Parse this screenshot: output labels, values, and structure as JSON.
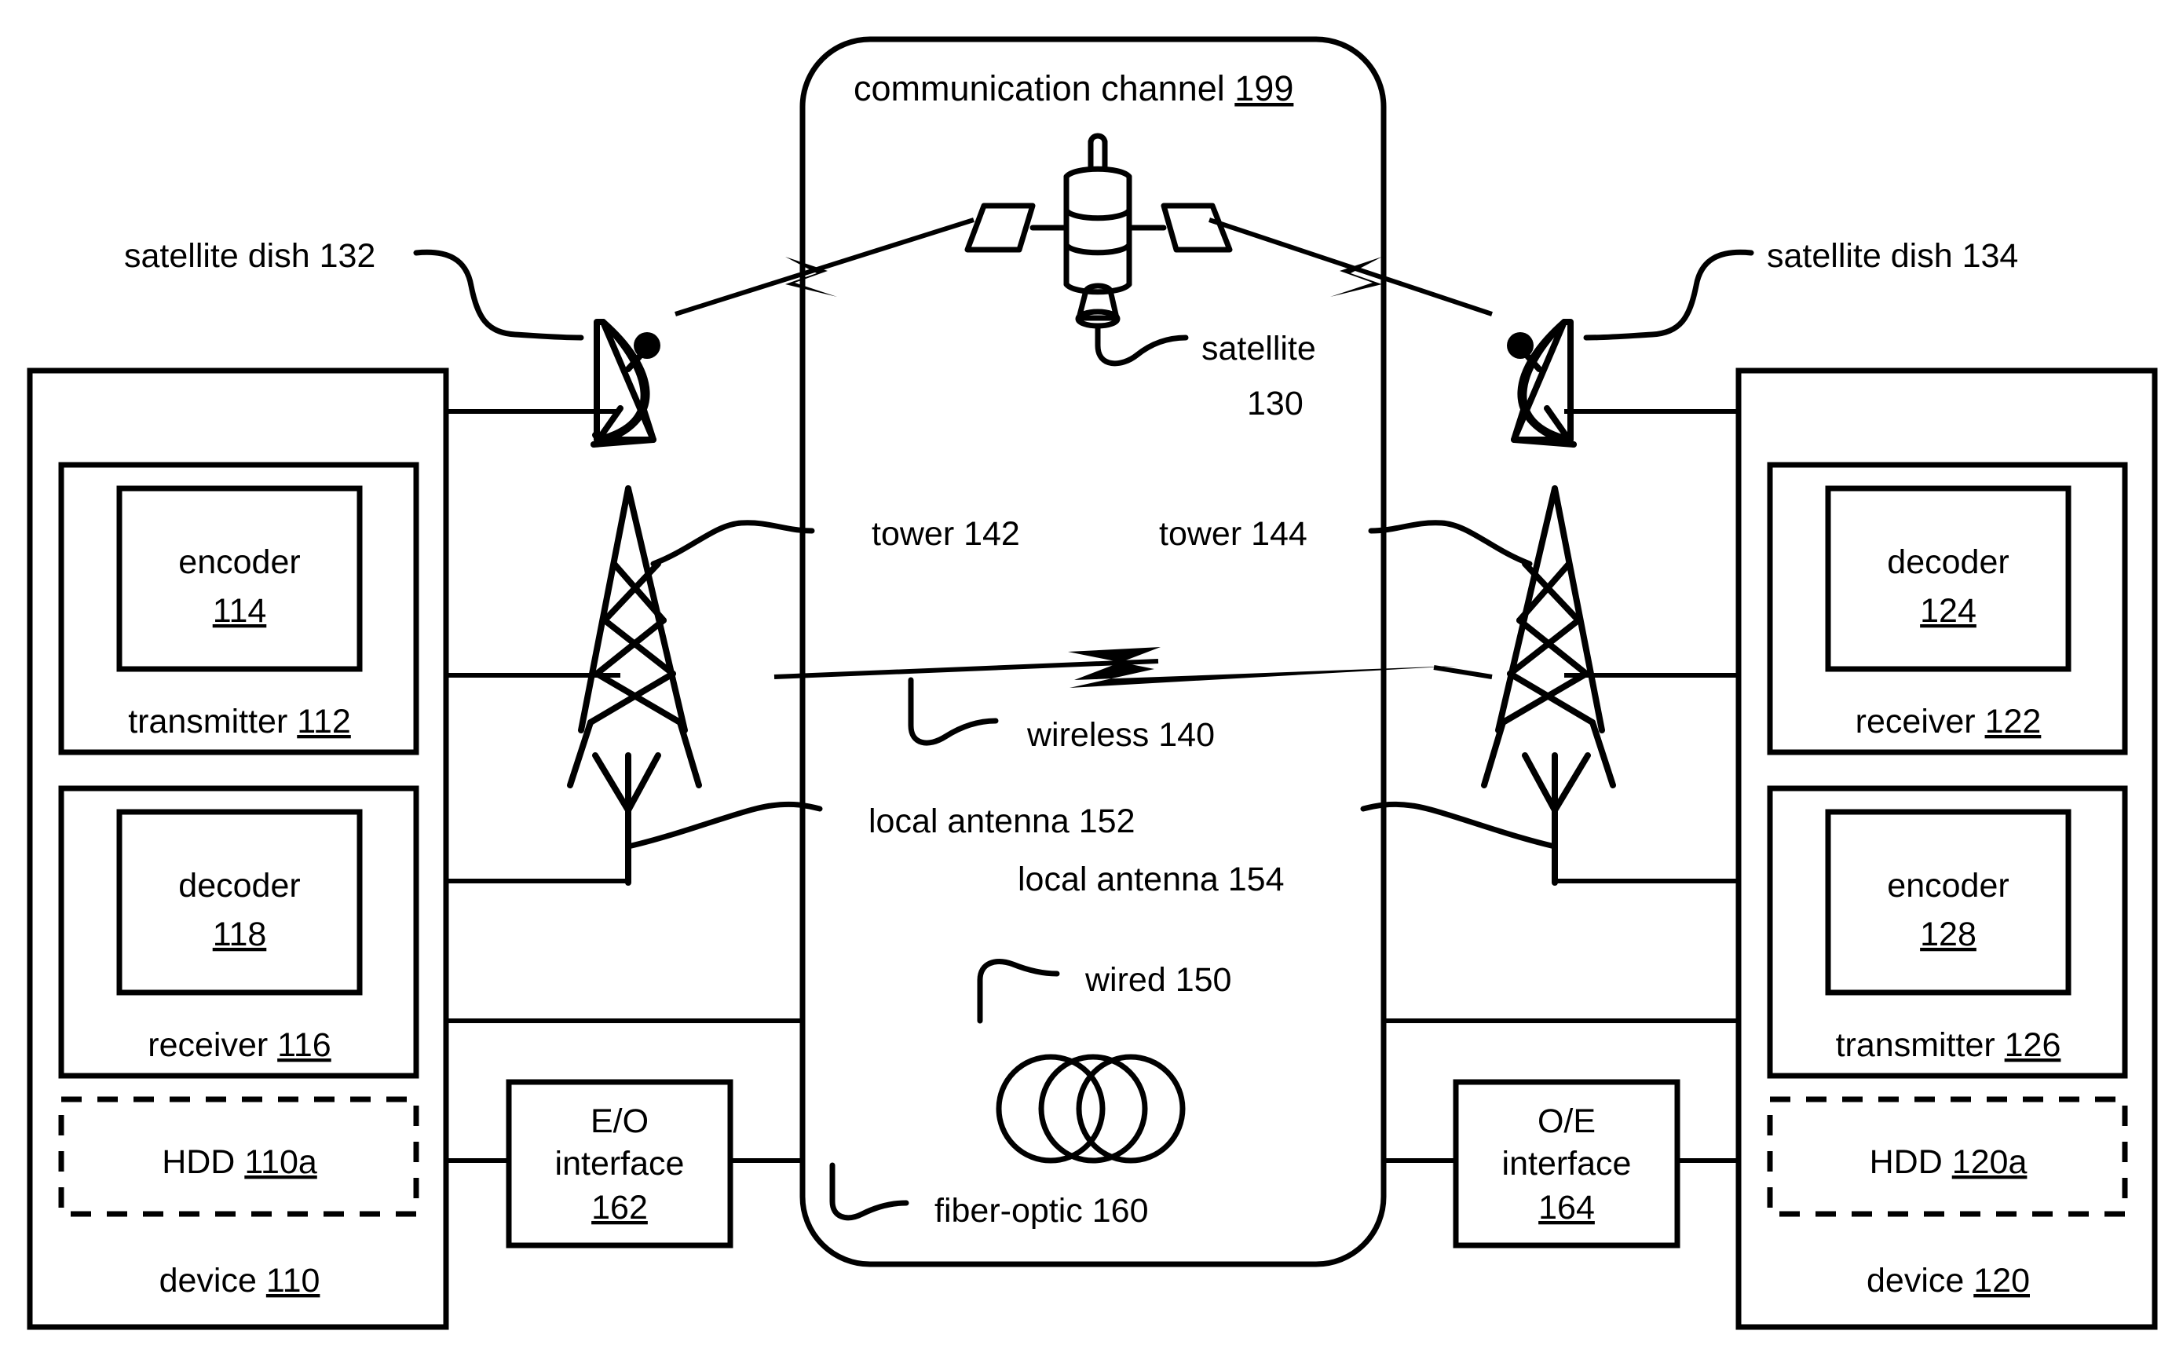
{
  "figure": {
    "title_region": "patent-figure-communication-system",
    "channel": {
      "label_text": "communication channel ",
      "label_ref": "199"
    },
    "left_device": {
      "device_label_text": "device ",
      "device_label_ref": "110",
      "transmitter_label_text": "transmitter ",
      "transmitter_label_ref": "112",
      "encoder_label_text": "encoder",
      "encoder_label_ref": "114",
      "receiver_label_text": "receiver ",
      "receiver_label_ref": "116",
      "decoder_label_text": "decoder",
      "decoder_label_ref": "118",
      "hdd_label_text": "HDD ",
      "hdd_label_ref": "110a"
    },
    "right_device": {
      "device_label_text": "device ",
      "device_label_ref": "120",
      "receiver_label_text": "receiver ",
      "receiver_label_ref": "122",
      "decoder_label_text": "decoder",
      "decoder_label_ref": "124",
      "transmitter_label_text": "transmitter ",
      "transmitter_label_ref": "126",
      "encoder_label_text": "encoder",
      "encoder_label_ref": "128",
      "hdd_label_text": "HDD ",
      "hdd_label_ref": "120a"
    },
    "media": {
      "satellite_dish_left": "satellite dish 132",
      "satellite_dish_right": "satellite dish 134",
      "satellite_line1": "satellite",
      "satellite_line2": "130",
      "tower_left": "tower 142",
      "tower_right": "tower 144",
      "wireless": "wireless 140",
      "local_antenna_left": "local antenna 152",
      "local_antenna_right": "local antenna 154",
      "wired": "wired 150",
      "fiber_optic": "fiber-optic 160"
    },
    "interfaces": {
      "eo_line1": "E/O",
      "eo_line2": "interface",
      "eo_ref": "162",
      "oe_line1": "O/E",
      "oe_line2": "interface",
      "oe_ref": "164"
    },
    "icons": {
      "satellite": "satellite-icon",
      "satellite_dish": "satellite-dish-icon",
      "tower": "radio-tower-icon",
      "antenna": "antenna-icon",
      "fiber_coil": "fiber-optic-coil-icon",
      "lightning": "lightning-bolt-icon"
    },
    "colors": {
      "ink": "#000000",
      "paper": "#ffffff"
    }
  }
}
